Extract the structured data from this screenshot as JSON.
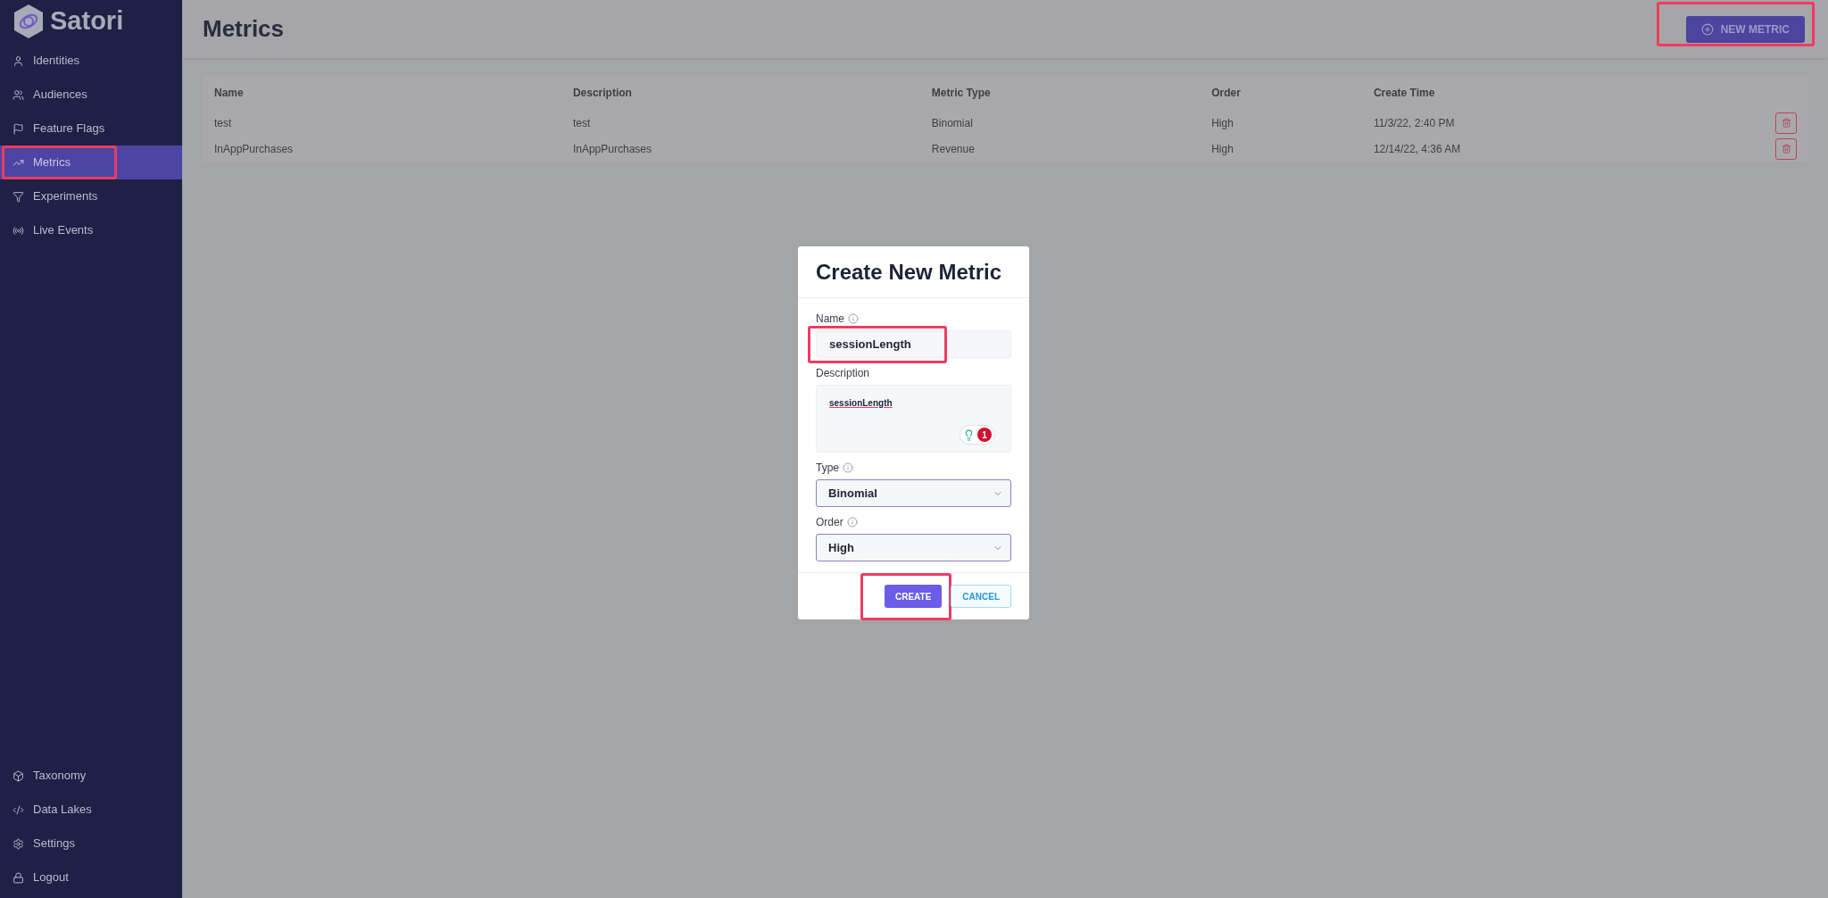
{
  "brand": {
    "name": "Satori"
  },
  "sidebar": {
    "items": [
      {
        "kind": "user",
        "label": "Identities",
        "selected": false,
        "highlighted": false
      },
      {
        "kind": "users",
        "label": "Audiences",
        "selected": false,
        "highlighted": false
      },
      {
        "kind": "flag",
        "label": "Feature Flags",
        "selected": false,
        "highlighted": false
      },
      {
        "kind": "trend",
        "label": "Metrics",
        "selected": true,
        "highlighted": true
      },
      {
        "kind": "funnel",
        "label": "Experiments",
        "selected": false,
        "highlighted": false
      },
      {
        "kind": "radio",
        "label": "Live Events",
        "selected": false,
        "highlighted": false
      }
    ],
    "bottom_items": [
      {
        "kind": "cube",
        "label": "Taxonomy",
        "selected": false,
        "highlighted": false
      },
      {
        "kind": "lake",
        "label": "Data Lakes",
        "selected": false,
        "highlighted": false
      },
      {
        "kind": "gear",
        "label": "Settings",
        "selected": false,
        "highlighted": false
      },
      {
        "kind": "lock",
        "label": "Logout",
        "selected": false,
        "highlighted": false
      }
    ]
  },
  "header": {
    "title": "Metrics",
    "new_button": {
      "label": "NEW METRIC",
      "highlighted": true
    }
  },
  "table": {
    "columns": [
      "Name",
      "Description",
      "Metric Type",
      "Order",
      "Create Time"
    ],
    "rows": [
      [
        "test",
        "test",
        "Binomial",
        "High",
        "11/3/22, 2:40 PM"
      ],
      [
        "InAppPurchases",
        "InAppPurchases",
        "Revenue",
        "High",
        "12/14/22, 4:36 AM"
      ]
    ]
  },
  "dialog": {
    "title": "Create New Metric",
    "fields": [
      {
        "kind": "input",
        "label": "Name",
        "info": true,
        "value": "sessionLength",
        "highlighted": true
      },
      {
        "kind": "textarea",
        "label": "Description",
        "info": false,
        "value": "sessionLength",
        "badge": "1",
        "highlighted": false
      },
      {
        "kind": "select",
        "label": "Type",
        "info": true,
        "value": "Binomial",
        "highlighted": false
      },
      {
        "kind": "select",
        "label": "Order",
        "info": true,
        "value": "High",
        "highlighted": false
      }
    ],
    "buttons": [
      {
        "kind": "primary",
        "label": "CREATE",
        "highlighted": true
      },
      {
        "kind": "secondary",
        "label": "CANCEL",
        "highlighted": false
      }
    ]
  }
}
